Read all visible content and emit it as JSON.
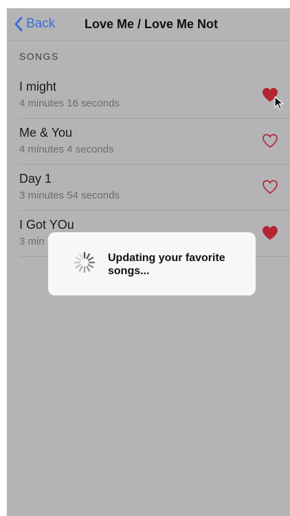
{
  "nav": {
    "back_label": "Back",
    "title": "Love Me / Love Me Not"
  },
  "section": {
    "header": "SONGS"
  },
  "songs": [
    {
      "title": "I might",
      "duration": "4 minutes 16 seconds",
      "favorite": true
    },
    {
      "title": "Me & You",
      "duration": "4 minutes 4 seconds",
      "favorite": false
    },
    {
      "title": "Day 1",
      "duration": "3 minutes 54 seconds",
      "favorite": false
    },
    {
      "title": "I Got YOu",
      "duration": "3 min",
      "favorite": true
    }
  ],
  "hud": {
    "message": "Updating your favorite songs..."
  },
  "colors": {
    "accent": "#3478f6",
    "heart": "#b42531",
    "dimmed_background": "#b4b4b6"
  },
  "icons": {
    "back": "chevron-left-icon",
    "heart_filled": "heart-filled-icon",
    "heart_outline": "heart-outline-icon",
    "spinner": "spinner-icon",
    "pointer": "mouse-pointer-icon"
  }
}
